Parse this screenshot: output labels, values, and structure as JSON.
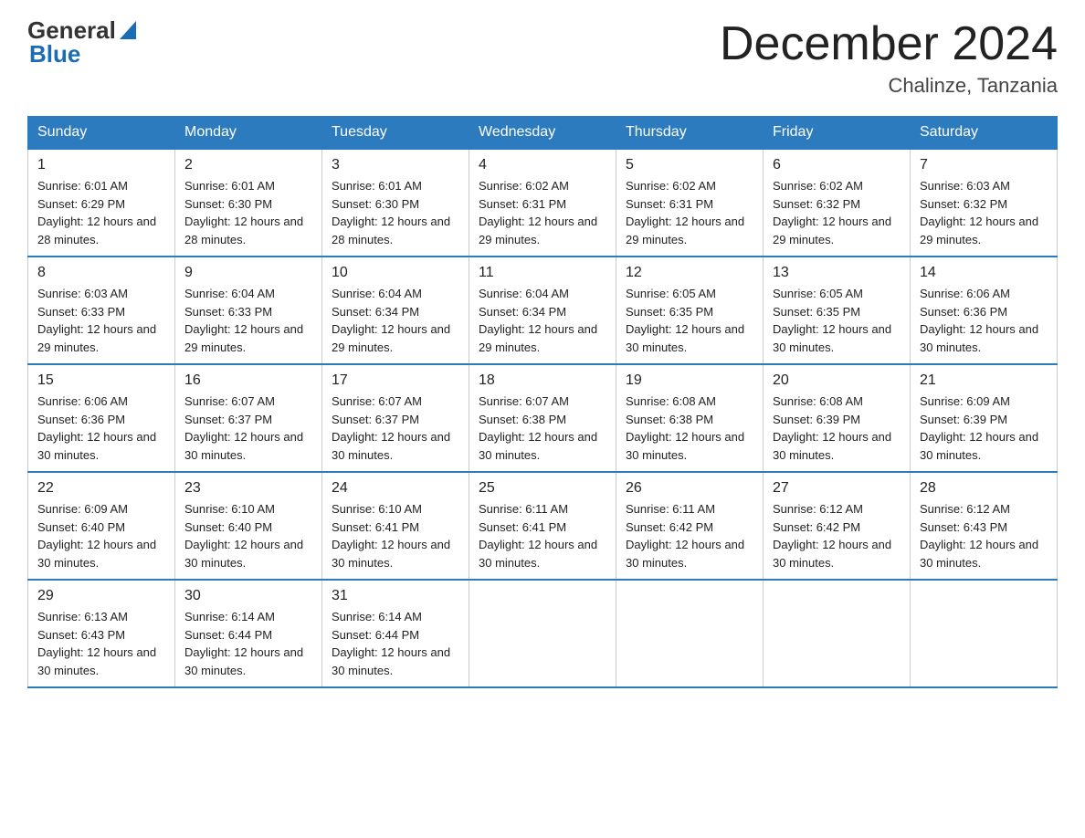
{
  "header": {
    "logo_general": "General",
    "logo_blue": "Blue",
    "month_title": "December 2024",
    "location": "Chalinze, Tanzania"
  },
  "weekdays": [
    "Sunday",
    "Monday",
    "Tuesday",
    "Wednesday",
    "Thursday",
    "Friday",
    "Saturday"
  ],
  "weeks": [
    [
      {
        "day": "1",
        "sunrise": "6:01 AM",
        "sunset": "6:29 PM",
        "daylight": "12 hours and 28 minutes."
      },
      {
        "day": "2",
        "sunrise": "6:01 AM",
        "sunset": "6:30 PM",
        "daylight": "12 hours and 28 minutes."
      },
      {
        "day": "3",
        "sunrise": "6:01 AM",
        "sunset": "6:30 PM",
        "daylight": "12 hours and 28 minutes."
      },
      {
        "day": "4",
        "sunrise": "6:02 AM",
        "sunset": "6:31 PM",
        "daylight": "12 hours and 29 minutes."
      },
      {
        "day": "5",
        "sunrise": "6:02 AM",
        "sunset": "6:31 PM",
        "daylight": "12 hours and 29 minutes."
      },
      {
        "day": "6",
        "sunrise": "6:02 AM",
        "sunset": "6:32 PM",
        "daylight": "12 hours and 29 minutes."
      },
      {
        "day": "7",
        "sunrise": "6:03 AM",
        "sunset": "6:32 PM",
        "daylight": "12 hours and 29 minutes."
      }
    ],
    [
      {
        "day": "8",
        "sunrise": "6:03 AM",
        "sunset": "6:33 PM",
        "daylight": "12 hours and 29 minutes."
      },
      {
        "day": "9",
        "sunrise": "6:04 AM",
        "sunset": "6:33 PM",
        "daylight": "12 hours and 29 minutes."
      },
      {
        "day": "10",
        "sunrise": "6:04 AM",
        "sunset": "6:34 PM",
        "daylight": "12 hours and 29 minutes."
      },
      {
        "day": "11",
        "sunrise": "6:04 AM",
        "sunset": "6:34 PM",
        "daylight": "12 hours and 29 minutes."
      },
      {
        "day": "12",
        "sunrise": "6:05 AM",
        "sunset": "6:35 PM",
        "daylight": "12 hours and 30 minutes."
      },
      {
        "day": "13",
        "sunrise": "6:05 AM",
        "sunset": "6:35 PM",
        "daylight": "12 hours and 30 minutes."
      },
      {
        "day": "14",
        "sunrise": "6:06 AM",
        "sunset": "6:36 PM",
        "daylight": "12 hours and 30 minutes."
      }
    ],
    [
      {
        "day": "15",
        "sunrise": "6:06 AM",
        "sunset": "6:36 PM",
        "daylight": "12 hours and 30 minutes."
      },
      {
        "day": "16",
        "sunrise": "6:07 AM",
        "sunset": "6:37 PM",
        "daylight": "12 hours and 30 minutes."
      },
      {
        "day": "17",
        "sunrise": "6:07 AM",
        "sunset": "6:37 PM",
        "daylight": "12 hours and 30 minutes."
      },
      {
        "day": "18",
        "sunrise": "6:07 AM",
        "sunset": "6:38 PM",
        "daylight": "12 hours and 30 minutes."
      },
      {
        "day": "19",
        "sunrise": "6:08 AM",
        "sunset": "6:38 PM",
        "daylight": "12 hours and 30 minutes."
      },
      {
        "day": "20",
        "sunrise": "6:08 AM",
        "sunset": "6:39 PM",
        "daylight": "12 hours and 30 minutes."
      },
      {
        "day": "21",
        "sunrise": "6:09 AM",
        "sunset": "6:39 PM",
        "daylight": "12 hours and 30 minutes."
      }
    ],
    [
      {
        "day": "22",
        "sunrise": "6:09 AM",
        "sunset": "6:40 PM",
        "daylight": "12 hours and 30 minutes."
      },
      {
        "day": "23",
        "sunrise": "6:10 AM",
        "sunset": "6:40 PM",
        "daylight": "12 hours and 30 minutes."
      },
      {
        "day": "24",
        "sunrise": "6:10 AM",
        "sunset": "6:41 PM",
        "daylight": "12 hours and 30 minutes."
      },
      {
        "day": "25",
        "sunrise": "6:11 AM",
        "sunset": "6:41 PM",
        "daylight": "12 hours and 30 minutes."
      },
      {
        "day": "26",
        "sunrise": "6:11 AM",
        "sunset": "6:42 PM",
        "daylight": "12 hours and 30 minutes."
      },
      {
        "day": "27",
        "sunrise": "6:12 AM",
        "sunset": "6:42 PM",
        "daylight": "12 hours and 30 minutes."
      },
      {
        "day": "28",
        "sunrise": "6:12 AM",
        "sunset": "6:43 PM",
        "daylight": "12 hours and 30 minutes."
      }
    ],
    [
      {
        "day": "29",
        "sunrise": "6:13 AM",
        "sunset": "6:43 PM",
        "daylight": "12 hours and 30 minutes."
      },
      {
        "day": "30",
        "sunrise": "6:14 AM",
        "sunset": "6:44 PM",
        "daylight": "12 hours and 30 minutes."
      },
      {
        "day": "31",
        "sunrise": "6:14 AM",
        "sunset": "6:44 PM",
        "daylight": "12 hours and 30 minutes."
      },
      null,
      null,
      null,
      null
    ]
  ]
}
